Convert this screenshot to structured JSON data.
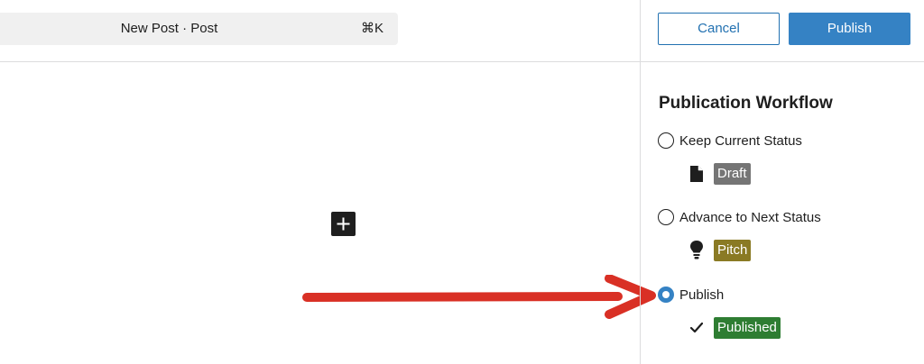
{
  "header": {
    "command_title": "New Post · Post",
    "command_shortcut": "⌘K"
  },
  "actions": {
    "cancel_label": "Cancel",
    "publish_label": "Publish"
  },
  "workflow": {
    "title": "Publication Workflow",
    "options": [
      {
        "label": "Keep Current Status",
        "selected": false,
        "status": {
          "label": "Draft",
          "icon": "document-icon",
          "color": "#757575"
        }
      },
      {
        "label": "Advance to Next Status",
        "selected": false,
        "status": {
          "label": "Pitch",
          "icon": "lightbulb-icon",
          "color": "#8a7a24"
        }
      },
      {
        "label": "Publish",
        "selected": true,
        "status": {
          "label": "Published",
          "icon": "checkmark-icon",
          "color": "#2e7d32"
        }
      }
    ]
  },
  "editor": {
    "add_block_icon": "plus-icon"
  },
  "annotation": {
    "arrow_color": "#d93025"
  },
  "colors": {
    "accent": "#3582c4",
    "link": "#2271b1"
  }
}
